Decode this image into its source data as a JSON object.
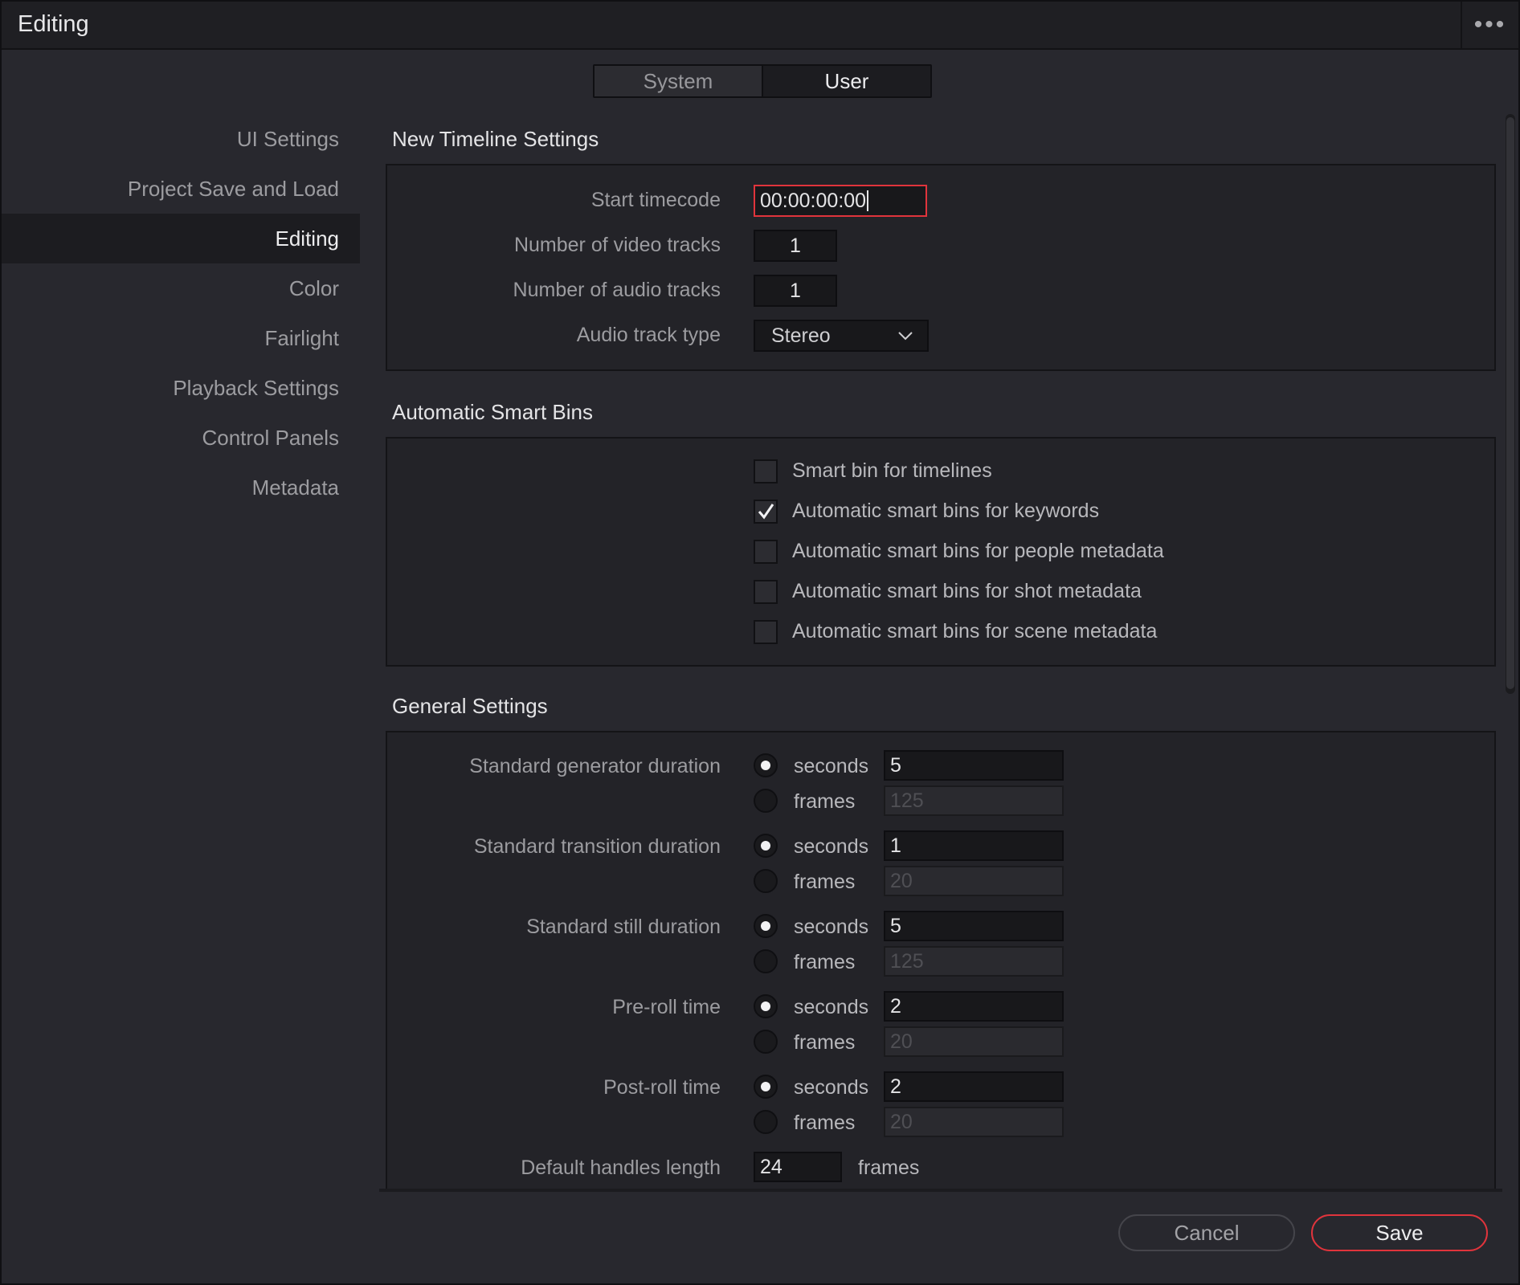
{
  "window": {
    "title": "Editing",
    "more": "•••"
  },
  "tabs": [
    {
      "label": "System",
      "active": false
    },
    {
      "label": "User",
      "active": true
    }
  ],
  "sidebar": {
    "items": [
      {
        "label": "UI Settings"
      },
      {
        "label": "Project Save and Load"
      },
      {
        "label": "Editing",
        "active": true
      },
      {
        "label": "Color"
      },
      {
        "label": "Fairlight"
      },
      {
        "label": "Playback Settings"
      },
      {
        "label": "Control Panels"
      },
      {
        "label": "Metadata"
      }
    ]
  },
  "new_timeline": {
    "title": "New Timeline Settings",
    "start_timecode": {
      "label": "Start timecode",
      "value": "00:00:00:00"
    },
    "video_tracks": {
      "label": "Number of video tracks",
      "value": "1"
    },
    "audio_tracks": {
      "label": "Number of audio tracks",
      "value": "1"
    },
    "audio_track_type": {
      "label": "Audio track type",
      "value": "Stereo"
    }
  },
  "smart_bins": {
    "title": "Automatic Smart Bins",
    "items": [
      {
        "label": "Smart bin for timelines",
        "checked": false
      },
      {
        "label": "Automatic smart bins for keywords",
        "checked": true
      },
      {
        "label": "Automatic smart bins for people metadata",
        "checked": false
      },
      {
        "label": "Automatic smart bins for shot metadata",
        "checked": false
      },
      {
        "label": "Automatic smart bins for scene metadata",
        "checked": false
      }
    ]
  },
  "general": {
    "title": "General Settings",
    "unit_seconds": "seconds",
    "unit_frames": "frames",
    "rows": [
      {
        "label": "Standard generator duration",
        "seconds": "5",
        "frames": "125"
      },
      {
        "label": "Standard transition duration",
        "seconds": "1",
        "frames": "20"
      },
      {
        "label": "Standard still duration",
        "seconds": "5",
        "frames": "125"
      },
      {
        "label": "Pre-roll time",
        "seconds": "2",
        "frames": "20"
      },
      {
        "label": "Post-roll time",
        "seconds": "2",
        "frames": "20"
      }
    ],
    "handles": {
      "label": "Default handles length",
      "value": "24",
      "unit": "frames"
    }
  },
  "footer": {
    "cancel_label": "Cancel",
    "save_label": "Save"
  },
  "colors": {
    "accent": "#e0343c",
    "background": "#28282e",
    "titlebar": "#1f1f23"
  }
}
